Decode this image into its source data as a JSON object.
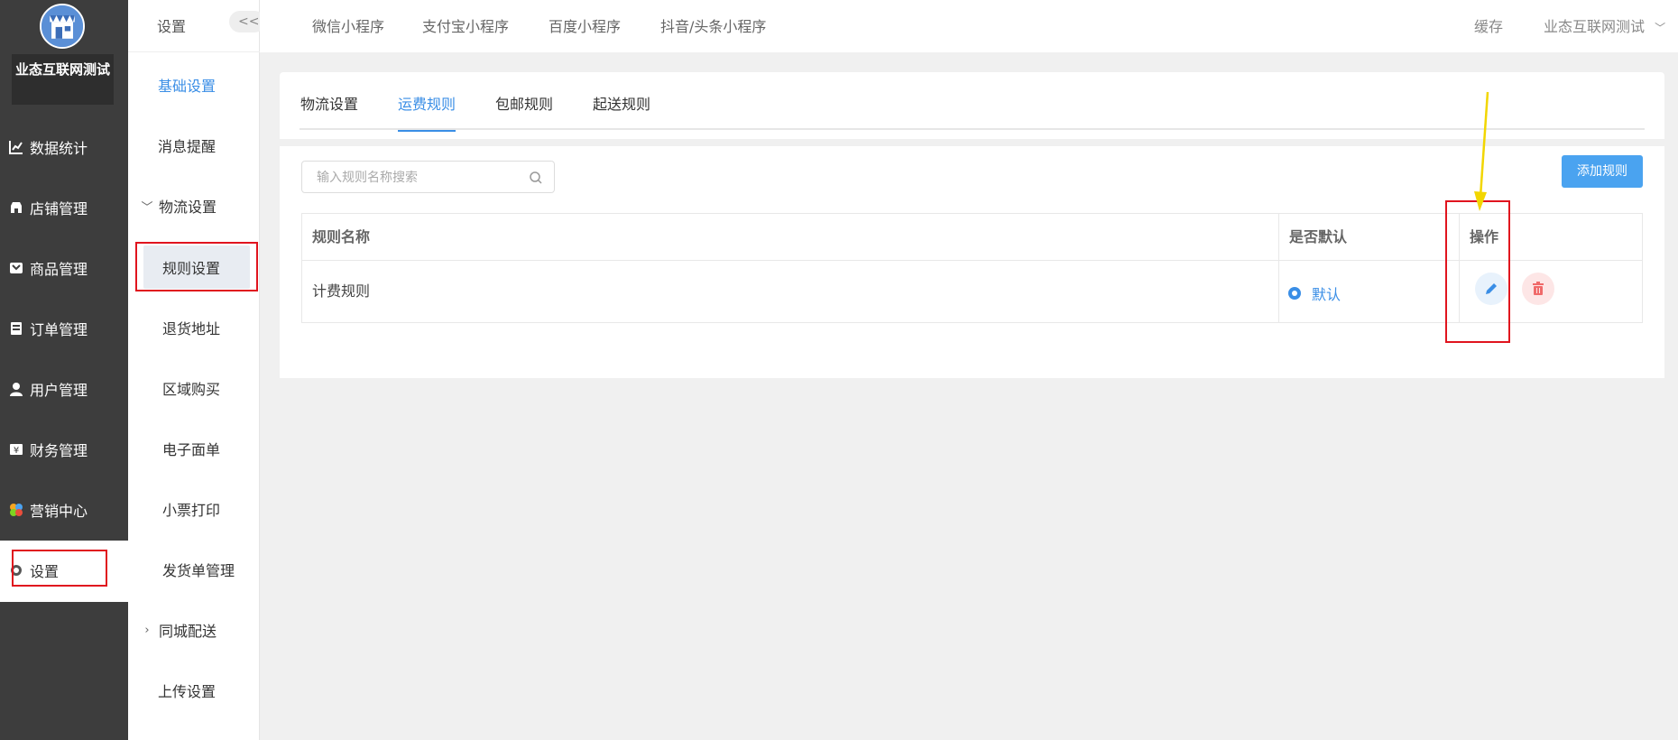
{
  "app": {
    "shop_name": "业态互联网测试"
  },
  "sidebar": {
    "items": [
      {
        "label": "数据统计",
        "icon": "chart-line-icon"
      },
      {
        "label": "店铺管理",
        "icon": "store-icon"
      },
      {
        "label": "商品管理",
        "icon": "product-icon"
      },
      {
        "label": "订单管理",
        "icon": "order-icon"
      },
      {
        "label": "用户管理",
        "icon": "user-icon"
      },
      {
        "label": "财务管理",
        "icon": "finance-icon"
      },
      {
        "label": "营销中心",
        "icon": "marketing-icon"
      },
      {
        "label": "设置",
        "icon": "gear-icon",
        "active": true
      }
    ]
  },
  "subnav": {
    "title": "设置",
    "collapse_label": "<<",
    "items": [
      {
        "label": "基础设置",
        "style": "blue"
      },
      {
        "label": "消息提醒"
      },
      {
        "label": "物流设置",
        "expander": "expanded"
      },
      {
        "label": "规则设置",
        "child": true,
        "selected": true
      },
      {
        "label": "退货地址",
        "child": true
      },
      {
        "label": "区域购买",
        "child": true
      },
      {
        "label": "电子面单",
        "child": true
      },
      {
        "label": "小票打印",
        "child": true
      },
      {
        "label": "发货单管理",
        "child": true
      },
      {
        "label": "同城配送",
        "expander": "collapsed"
      },
      {
        "label": "上传设置"
      }
    ]
  },
  "topbar": {
    "links": [
      "微信小程序",
      "支付宝小程序",
      "百度小程序",
      "抖音/头条小程序"
    ],
    "cache_label": "缓存",
    "account_label": "业态互联网测试"
  },
  "tabs": {
    "items": [
      "物流设置",
      "运费规则",
      "包邮规则",
      "起送规则"
    ],
    "active_index": 1
  },
  "toolbar": {
    "search_placeholder": "输入规则名称搜索",
    "add_label": "添加规则"
  },
  "table": {
    "headers": [
      "规则名称",
      "是否默认",
      "操作"
    ],
    "rows": [
      {
        "name": "计费规则",
        "default_label": "默认"
      }
    ]
  },
  "colors": {
    "accent": "#3a8ee6",
    "sidebar_bg": "#3d3d3d",
    "button_bg": "#4aa3f0",
    "annotation_red": "#e0141e",
    "annotation_yellow": "#f2d600"
  }
}
